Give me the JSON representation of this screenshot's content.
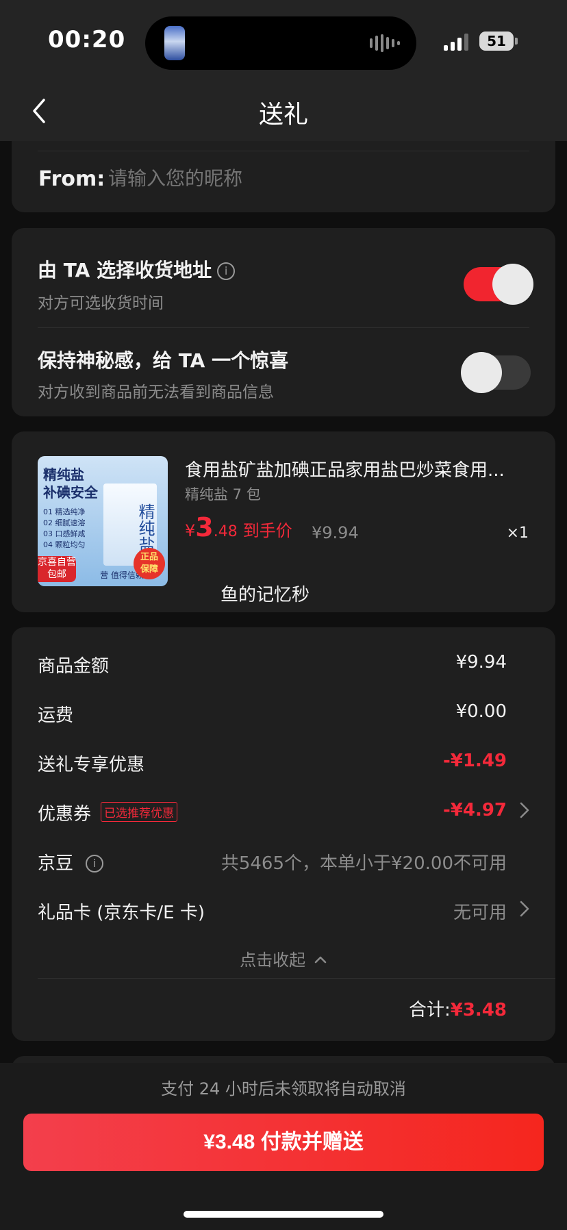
{
  "status_bar": {
    "time": "00:20",
    "battery": "51"
  },
  "nav": {
    "title": "送礼"
  },
  "from": {
    "label": "From:",
    "placeholder": "请输入您的昵称"
  },
  "options": {
    "address": {
      "title": "由 TA 选择收货地址",
      "subtitle": "对方可选收货时间",
      "enabled": true
    },
    "mystery": {
      "title": "保持神秘感，给 TA 一个惊喜",
      "subtitle": "对方收到商品前无法看到商品信息",
      "enabled": false
    }
  },
  "product": {
    "title": "食用盐矿盐加碘正品家用盐巴炒菜食用...",
    "spec": "精纯盐 7 包",
    "price_symbol": "¥",
    "price_int": "3",
    "price_dec": ".48",
    "price_tag": "到手价",
    "original_price": "¥9.94",
    "quantity": "×1",
    "nickname": "鱼的记忆秒",
    "image_text": {
      "headline1": "精纯盐",
      "headline2": "补碘安全",
      "bag": "精纯盐",
      "list": [
        "01 精选纯净",
        "02 细腻速溶",
        "03 口感鲜咸",
        "04 颗粒均匀"
      ],
      "badge_left1": "京喜自营",
      "badge_left2": "包邮",
      "badge_right1": "正品",
      "badge_right2": "保障",
      "footer": "营 值得信赖"
    }
  },
  "summary": {
    "goods_label": "商品金额",
    "goods_value": "¥9.94",
    "shipping_label": "运费",
    "shipping_value": "¥0.00",
    "gift_discount_label": "送礼专享优惠",
    "gift_discount_value": "-¥1.49",
    "coupon_label": "优惠券",
    "coupon_tag": "已选推荐优惠",
    "coupon_value": "-¥4.97",
    "jingdou_label": "京豆",
    "jingdou_value": "共5465个，本单小于¥20.00不可用",
    "giftcard_label": "礼品卡 (京东卡/E 卡)",
    "giftcard_value": "无可用",
    "collapse": "点击收起",
    "total_label": "合计:",
    "total_value": "¥3.48"
  },
  "footer": {
    "hint": "支付 24 小时后未领取将自动取消",
    "pay_button": "¥3.48 付款并赠送"
  },
  "colors": {
    "accent": "#f4293a",
    "button_start": "#f33f4c",
    "button_end": "#f5261e",
    "card": "#1f1f1f"
  }
}
